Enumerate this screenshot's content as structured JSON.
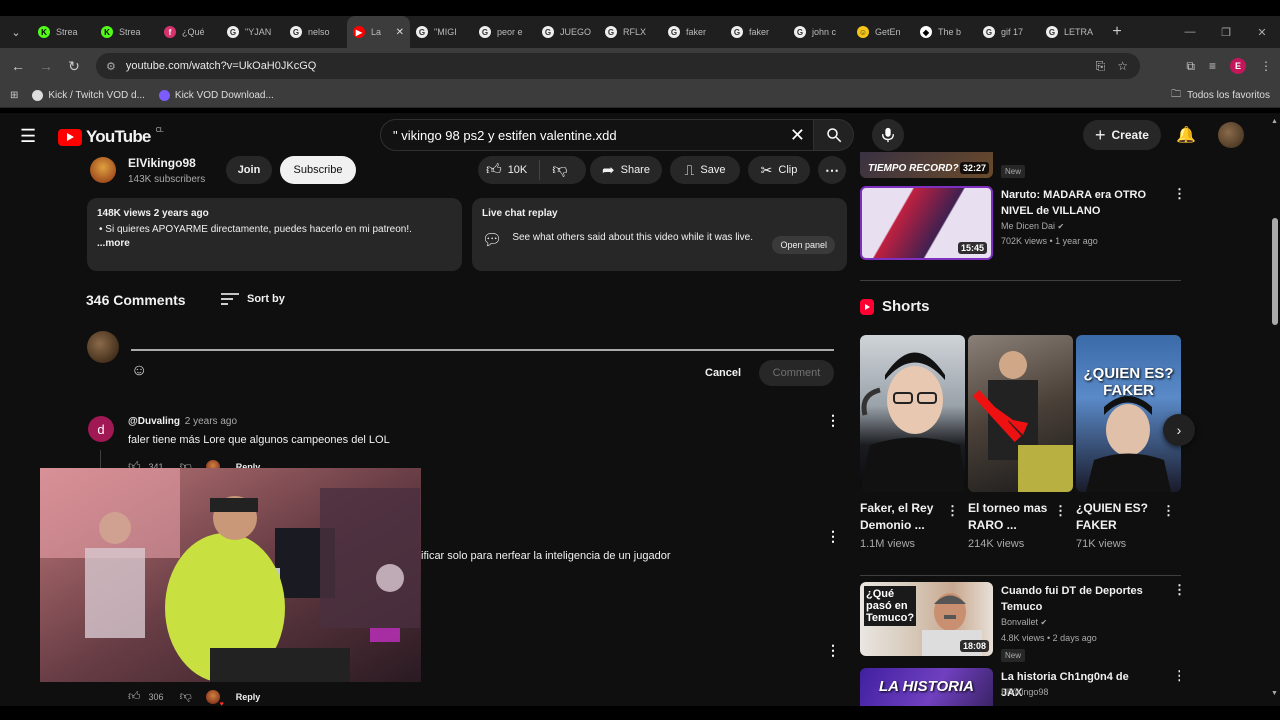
{
  "browser": {
    "tabs": [
      {
        "label": "Strea",
        "fav_text": "K",
        "fav_color": "#53fc18",
        "fav_fg": "#000"
      },
      {
        "label": "Strea",
        "fav_text": "K",
        "fav_color": "#53fc18",
        "fav_fg": "#000"
      },
      {
        "label": "¿Qué",
        "fav_text": "f",
        "fav_color": "#d6336c",
        "fav_fg": "#fff"
      },
      {
        "label": "\"YJAN",
        "fav_text": "G",
        "fav_color": "#eeeeee",
        "fav_fg": "#333"
      },
      {
        "label": "nelso",
        "fav_text": "G",
        "fav_color": "#eeeeee",
        "fav_fg": "#333"
      },
      {
        "label": "La",
        "fav_text": "▶",
        "fav_color": "#ff0000",
        "fav_fg": "#fff",
        "active": true
      },
      {
        "label": "\"MIGI",
        "fav_text": "G",
        "fav_color": "#eeeeee",
        "fav_fg": "#333"
      },
      {
        "label": "peor e",
        "fav_text": "G",
        "fav_color": "#eeeeee",
        "fav_fg": "#333"
      },
      {
        "label": "JUEGO",
        "fav_text": "G",
        "fav_color": "#eeeeee",
        "fav_fg": "#333"
      },
      {
        "label": "RFLX",
        "fav_text": "G",
        "fav_color": "#eeeeee",
        "fav_fg": "#333"
      },
      {
        "label": "faker",
        "fav_text": "G",
        "fav_color": "#eeeeee",
        "fav_fg": "#333"
      },
      {
        "label": "faker",
        "fav_text": "G",
        "fav_color": "#eeeeee",
        "fav_fg": "#333"
      },
      {
        "label": "john c",
        "fav_text": "G",
        "fav_color": "#eeeeee",
        "fav_fg": "#333"
      },
      {
        "label": "GetEn",
        "fav_text": "☺",
        "fav_color": "#f5c518",
        "fav_fg": "#333"
      },
      {
        "label": "The b",
        "fav_text": "◆",
        "fav_color": "#ffffff",
        "fav_fg": "#000"
      },
      {
        "label": "gif 17",
        "fav_text": "G",
        "fav_color": "#eeeeee",
        "fav_fg": "#333"
      },
      {
        "label": "LETRA",
        "fav_text": "G",
        "fav_color": "#eeeeee",
        "fav_fg": "#333"
      }
    ],
    "url": "youtube.com/watch?v=UkOaH0JKcGQ",
    "bookmarks": [
      {
        "label": "Kick / Twitch VOD d...",
        "icon_color": "#dddddd"
      },
      {
        "label": "Kick VOD Download...",
        "icon_color": "#7c5cff"
      }
    ],
    "all_bookmarks": "Todos los favoritos",
    "profile_letter": "E"
  },
  "youtube": {
    "logo": "YouTube",
    "region": "CL",
    "search_query": "\" vikingo 98 ps2 y estifen valentine.xdd",
    "create_label": "Create"
  },
  "channel": {
    "name": "ElVikingo98",
    "subs": "143K subscribers",
    "join": "Join",
    "subscribe": "Subscribe",
    "likes": "10K",
    "share": "Share",
    "save": "Save",
    "clip": "Clip"
  },
  "description": {
    "meta": "148K views  2 years ago",
    "line": "Si quieres APOYARME directamente, puedes hacerlo en mi patreon!.",
    "more": "...more"
  },
  "live_chat": {
    "title": "Live chat replay",
    "text": "See what others said about this video while it was live.",
    "open": "Open panel"
  },
  "comments": {
    "count": "346 Comments",
    "sort": "Sort by",
    "cancel": "Cancel",
    "submit": "Comment",
    "items": [
      {
        "avatar_letter": "d",
        "author": "@Duvaling",
        "time": "2 years ago",
        "text": "faler tiene más Lore que algunos campeones del LOL",
        "likes": "341",
        "reply": "Reply"
      },
      {
        "text": "ificar solo para nerfear la inteligencia de un jugador"
      },
      {
        "likes": "306",
        "reply": "Reply"
      }
    ]
  },
  "sidebar": {
    "videos": [
      {
        "title": "TIEMPO RECORD?",
        "duration": "32:27",
        "views": "",
        "new": "New"
      },
      {
        "title": "Naruto: MADARA era OTRO NIVEL de VILLANO",
        "channel": "Me Dicen Dai",
        "views": "702K views • 1 year ago",
        "duration": "15:45"
      },
      {
        "title": "Cuando fui DT de Deportes Temuco",
        "channel": "Bonvallet",
        "views": "4.8K views • 2 days ago",
        "duration": "18:08",
        "new": "New",
        "thumb_text": "¿Qué pasó en Temuco?"
      },
      {
        "title": "La historia Ch1ng0n4 de JAX",
        "channel": "ElVikingo98",
        "thumb_text": "LA HISTORIA"
      }
    ],
    "shorts_title": "Shorts",
    "shorts": [
      {
        "title": "Faker, el Rey Demonio ...",
        "views": "1.1M views"
      },
      {
        "title": "El torneo mas RARO ...",
        "views": "214K views"
      },
      {
        "title": "¿QUIEN ES? FAKER",
        "views": "71K views",
        "thumb_text": "¿QUIEN ES? FAKER"
      }
    ]
  },
  "colors": {
    "background": "#0f0f0f",
    "accent_red": "#ff0000",
    "pill": "#272727"
  }
}
